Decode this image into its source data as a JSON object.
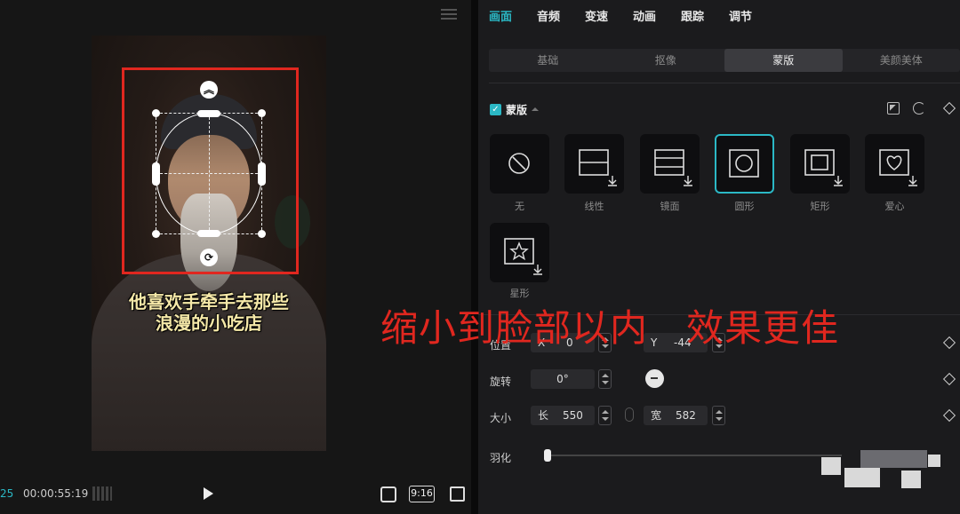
{
  "preview": {
    "caption_line1": "他喜欢手牵手去那些",
    "caption_line2": "浪漫的小吃店",
    "playbar": {
      "frame_end": "25",
      "timecode": "00:00:55:19",
      "ratio_label": "9:16"
    }
  },
  "inspector": {
    "top_tabs": [
      "画面",
      "音频",
      "变速",
      "动画",
      "跟踪",
      "调节"
    ],
    "active_top_tab": "画面",
    "sub_tabs": [
      "基础",
      "抠像",
      "蒙版",
      "美颜美体"
    ],
    "active_sub_tab": "蒙版",
    "mask_section": {
      "title": "蒙版",
      "checked": true,
      "shapes": [
        {
          "label": "无",
          "icon": "none-icon",
          "selected": false
        },
        {
          "label": "线性",
          "icon": "linear-mask-icon",
          "selected": false
        },
        {
          "label": "镜面",
          "icon": "mirror-mask-icon",
          "selected": false
        },
        {
          "label": "圆形",
          "icon": "circle-mask-icon",
          "selected": true
        },
        {
          "label": "矩形",
          "icon": "rectangle-mask-icon",
          "selected": false
        },
        {
          "label": "爱心",
          "icon": "heart-mask-icon",
          "selected": false
        },
        {
          "label": "星形",
          "icon": "star-mask-icon",
          "selected": false
        }
      ]
    },
    "properties": {
      "position": {
        "label": "位置",
        "x_prefix": "X",
        "x": "0",
        "y_prefix": "Y",
        "y": "-44"
      },
      "rotation": {
        "label": "旋转",
        "value": "0°"
      },
      "size": {
        "label": "大小",
        "w_prefix": "长",
        "w": "550",
        "h_prefix": "宽",
        "h": "582"
      },
      "feather": {
        "label": "羽化",
        "level": 0
      }
    }
  },
  "annotation_text": "缩小到脸部以内   效果更佳",
  "colors": {
    "accent": "#2bb8c5",
    "annotation_red": "#e0271f",
    "panel_bg": "#1b1b1d"
  }
}
